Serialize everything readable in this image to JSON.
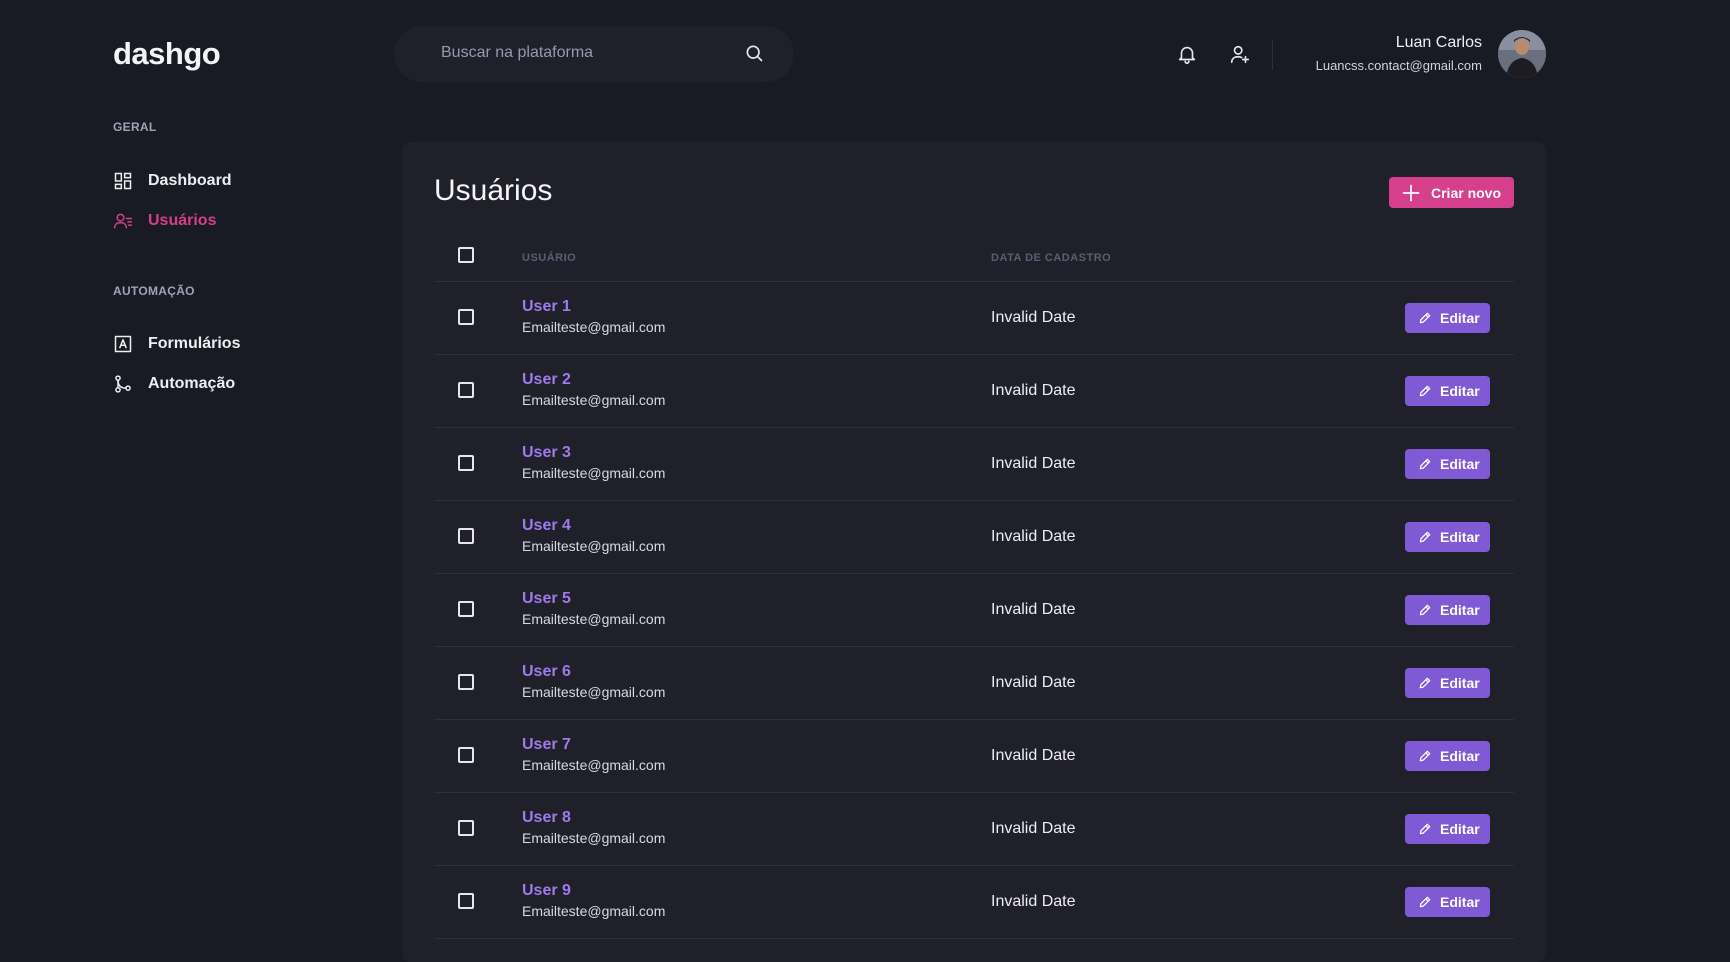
{
  "app": {
    "logo": "dashgo"
  },
  "header": {
    "search_placeholder": "Buscar na plataforma",
    "user_name": "Luan Carlos",
    "user_email": "Luancss.contact@gmail.com",
    "icons": [
      "bell-icon",
      "user-add-icon"
    ]
  },
  "sidebar": {
    "sections": [
      {
        "title": "GERAL",
        "items": [
          {
            "label": "Dashboard",
            "icon": "dashboard-icon",
            "active": false
          },
          {
            "label": "Usuários",
            "icon": "users-icon",
            "active": true
          }
        ]
      },
      {
        "title": "AUTOMAÇÃO",
        "items": [
          {
            "label": "Formulários",
            "icon": "form-icon",
            "active": false
          },
          {
            "label": "Automação",
            "icon": "git-merge-icon",
            "active": false
          }
        ]
      }
    ]
  },
  "main": {
    "title": "Usuários",
    "create_label": "Criar novo",
    "columns": [
      "USUÁRIO",
      "DATA DE CADASTRO"
    ],
    "edit_label": "Editar",
    "rows": [
      {
        "name": "User 1",
        "email": "Emailteste@gmail.com",
        "date": "Invalid Date"
      },
      {
        "name": "User 2",
        "email": "Emailteste@gmail.com",
        "date": "Invalid Date"
      },
      {
        "name": "User 3",
        "email": "Emailteste@gmail.com",
        "date": "Invalid Date"
      },
      {
        "name": "User 4",
        "email": "Emailteste@gmail.com",
        "date": "Invalid Date"
      },
      {
        "name": "User 5",
        "email": "Emailteste@gmail.com",
        "date": "Invalid Date"
      },
      {
        "name": "User 6",
        "email": "Emailteste@gmail.com",
        "date": "Invalid Date"
      },
      {
        "name": "User 7",
        "email": "Emailteste@gmail.com",
        "date": "Invalid Date"
      },
      {
        "name": "User 8",
        "email": "Emailteste@gmail.com",
        "date": "Invalid Date"
      },
      {
        "name": "User 9",
        "email": "Emailteste@gmail.com",
        "date": "Invalid Date"
      }
    ]
  },
  "colors": {
    "background": "#181b23",
    "panel": "#1f2029",
    "accent_pink": "#d53f8c",
    "accent_purple": "#805ad5",
    "link_purple": "#9f7aea"
  }
}
